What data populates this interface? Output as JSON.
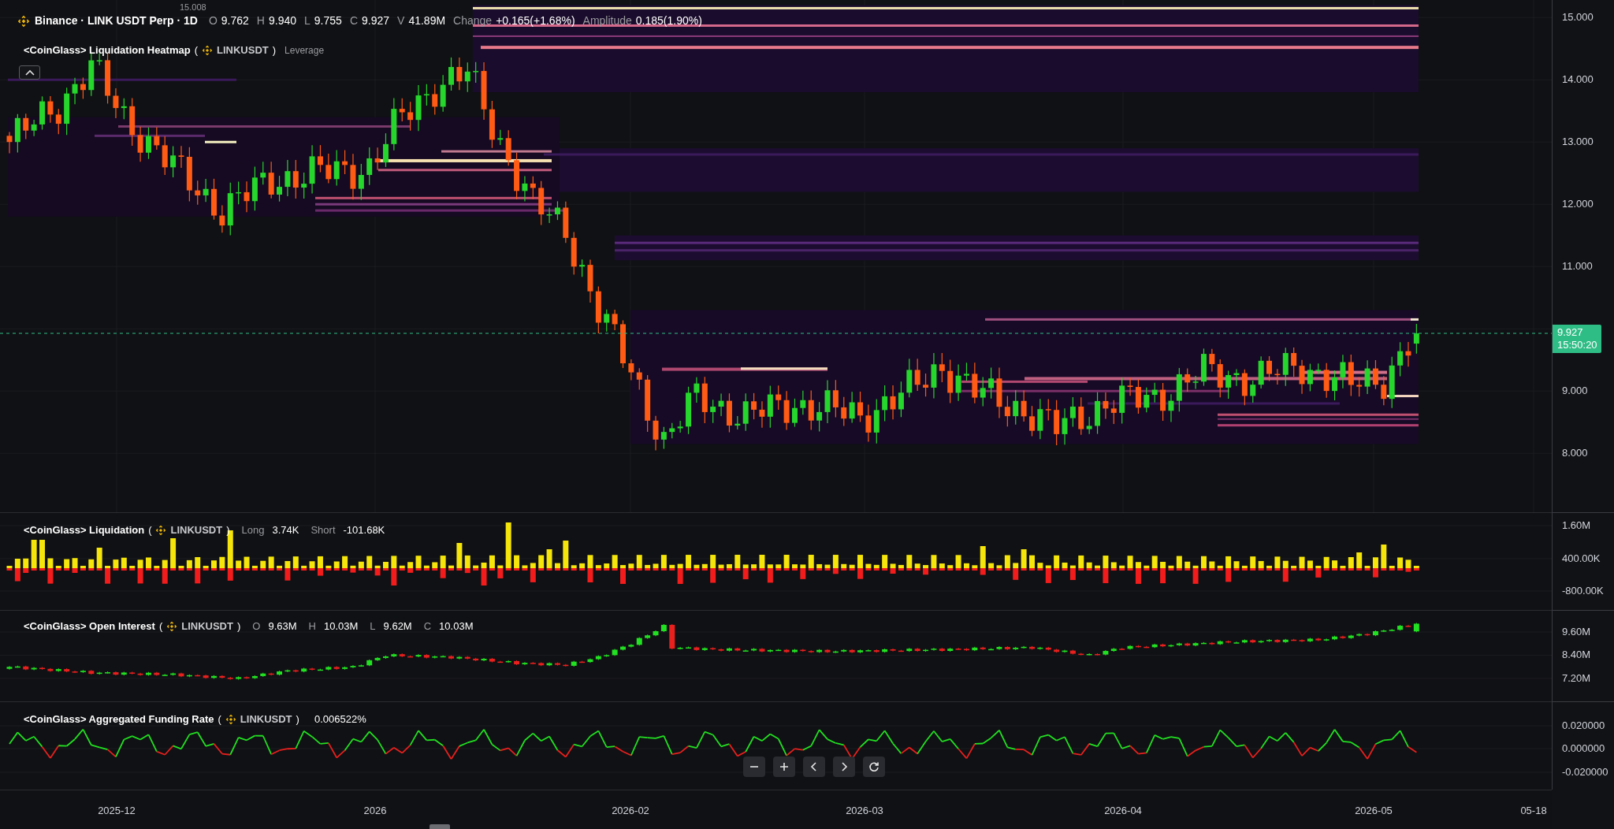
{
  "header": {
    "title": "Binance · LINK USDT Perp · 1D",
    "ohlc": [
      {
        "label": "O",
        "value": "9.762"
      },
      {
        "label": "H",
        "value": "9.940"
      },
      {
        "label": "L",
        "value": "9.755"
      },
      {
        "label": "C",
        "value": "9.927"
      },
      {
        "label": "V",
        "value": "41.89M"
      }
    ],
    "stats": [
      {
        "label": "Change",
        "value": "+0.165(+1.68%)"
      },
      {
        "label": "Amplitude",
        "value": "0.185(1.90%)"
      }
    ]
  },
  "main_pane": {
    "indicator": {
      "name": "<CoinGlass> Liquidation Heatmap",
      "open_paren": "(",
      "symbol": "LINKUSDT",
      "close_paren": ")",
      "setting": "Leverage"
    },
    "high_marker": "15.008",
    "price_axis": [
      "15.000",
      "14.000",
      "13.000",
      "12.000",
      "11.000",
      "9.000",
      "8.000"
    ],
    "last_price": "9.927",
    "countdown": "15:50:20"
  },
  "liquidation_pane": {
    "name": "<CoinGlass> Liquidation",
    "open_paren": "(",
    "symbol": "LINKUSDT",
    "close_paren": ")",
    "stats": [
      {
        "label": "Long",
        "value": "3.74K"
      },
      {
        "label": "Short",
        "value": "-101.68K"
      }
    ],
    "axis": [
      "1.60M",
      "400.00K",
      "-800.00K"
    ]
  },
  "open_interest_pane": {
    "name": "<CoinGlass> Open Interest",
    "open_paren": "(",
    "symbol": "LINKUSDT",
    "close_paren": ")",
    "stats": [
      {
        "label": "O",
        "value": "9.63M"
      },
      {
        "label": "H",
        "value": "10.03M"
      },
      {
        "label": "L",
        "value": "9.62M"
      },
      {
        "label": "C",
        "value": "10.03M"
      }
    ],
    "axis": [
      "9.60M",
      "8.40M",
      "7.20M"
    ]
  },
  "funding_pane": {
    "name": "<CoinGlass> Aggregated Funding Rate",
    "open_paren": "(",
    "symbol": "LINKUSDT",
    "close_paren": ")",
    "value": "0.006522%",
    "axis": [
      "0.020000",
      "0.000000",
      "-0.020000"
    ]
  },
  "controls": [
    {
      "kind": "zoom-out"
    },
    {
      "kind": "zoom-in"
    },
    {
      "kind": "scroll-left"
    },
    {
      "kind": "scroll-right"
    },
    {
      "kind": "reset"
    }
  ],
  "time_axis": [
    "2025-12",
    "2026",
    "2026-02",
    "2026-03",
    "2026-04",
    "2026-05",
    "05-18"
  ]
}
